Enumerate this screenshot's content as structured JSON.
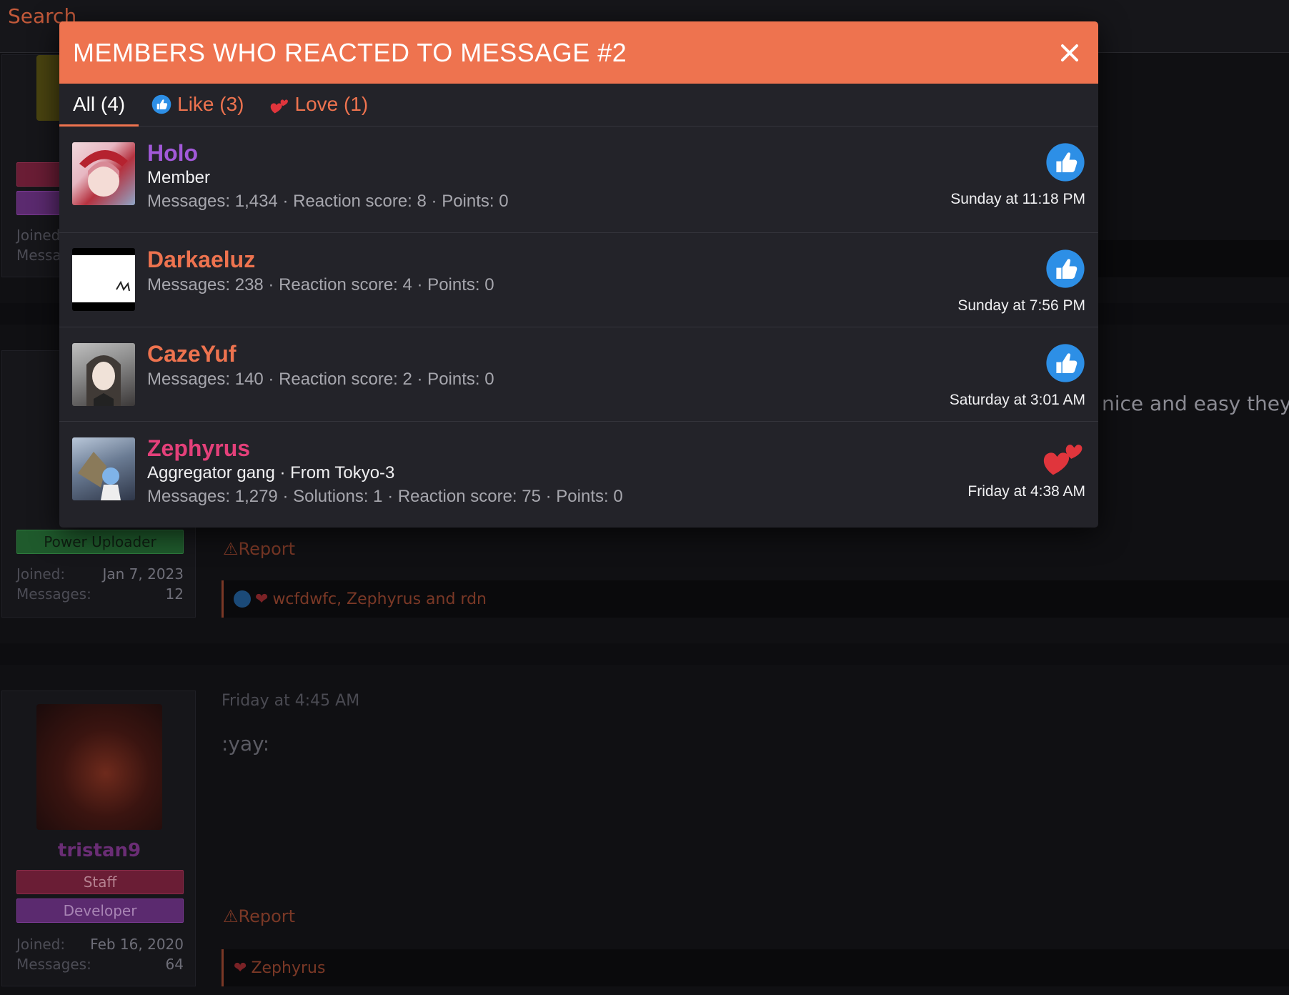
{
  "topbar": {
    "search_label": "Search"
  },
  "modal": {
    "title": "MEMBERS WHO REACTED TO MESSAGE #2",
    "close_icon": "close-icon",
    "tabs": [
      {
        "label": "All (4)",
        "icon": ""
      },
      {
        "label": "Like (3)",
        "icon": "like-icon"
      },
      {
        "label": "Love (1)",
        "icon": "love-icon"
      }
    ],
    "members": [
      {
        "name": "Holo",
        "name_color": "#a259d9",
        "title": "Member",
        "stats": "Messages: 1,434 · Reaction score: 8 · Points: 0",
        "reaction": "like-icon",
        "time": "Sunday at 11:18 PM"
      },
      {
        "name": "Darkaeluz",
        "name_color": "#ee734f",
        "title": "",
        "stats": "Messages: 238 · Reaction score: 4 · Points: 0",
        "reaction": "like-icon",
        "time": "Sunday at 7:56 PM"
      },
      {
        "name": "CazeYuf",
        "name_color": "#ee734f",
        "title": "",
        "stats": "Messages: 140 · Reaction score: 2 · Points: 0",
        "reaction": "like-icon",
        "time": "Saturday at 3:01 AM"
      },
      {
        "name": "Zephyrus",
        "name_color": "#e4407a",
        "title": "Aggregator gang · From Tokyo-3",
        "stats": "Messages: 1,279 · Solutions: 1 · Reaction score: 75 · Points: 0",
        "reaction": "love-icon",
        "time": "Friday at 4:38 AM"
      }
    ]
  },
  "background": {
    "post1": {
      "joined_label": "Joined",
      "messages_label": "Messa"
    },
    "post2": {
      "badge": "Power Uploader",
      "joined_label": "Joined:",
      "joined_value": "Jan 7, 2023",
      "messages_label": "Messages:",
      "messages_value": "12",
      "report": "Report",
      "reactions_text": "wcfdwfc, Zephyrus and rdn",
      "body_fragment": "nice and easy they w"
    },
    "post3": {
      "timestamp": "Friday at 4:45 AM",
      "body": ":yay:",
      "username": "tristan9",
      "badge_staff": "Staff",
      "badge_dev": "Developer",
      "joined_label": "Joined:",
      "joined_value": "Feb 16, 2020",
      "messages_label": "Messages:",
      "messages_value": "64",
      "report": "Report",
      "reactions_text": "Zephyrus"
    }
  },
  "colors": {
    "accent": "#ee734f",
    "like": "#2d8fe6",
    "love": "#e0353c"
  }
}
